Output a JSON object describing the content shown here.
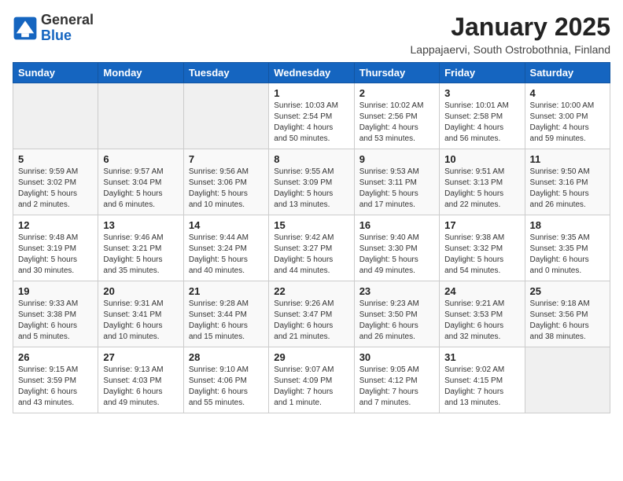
{
  "logo": {
    "general": "General",
    "blue": "Blue"
  },
  "title": "January 2025",
  "subtitle": "Lappajaervi, South Ostrobothnia, Finland",
  "weekdays": [
    "Sunday",
    "Monday",
    "Tuesday",
    "Wednesday",
    "Thursday",
    "Friday",
    "Saturday"
  ],
  "weeks": [
    [
      {
        "day": "",
        "detail": ""
      },
      {
        "day": "",
        "detail": ""
      },
      {
        "day": "",
        "detail": ""
      },
      {
        "day": "1",
        "detail": "Sunrise: 10:03 AM\nSunset: 2:54 PM\nDaylight: 4 hours\nand 50 minutes."
      },
      {
        "day": "2",
        "detail": "Sunrise: 10:02 AM\nSunset: 2:56 PM\nDaylight: 4 hours\nand 53 minutes."
      },
      {
        "day": "3",
        "detail": "Sunrise: 10:01 AM\nSunset: 2:58 PM\nDaylight: 4 hours\nand 56 minutes."
      },
      {
        "day": "4",
        "detail": "Sunrise: 10:00 AM\nSunset: 3:00 PM\nDaylight: 4 hours\nand 59 minutes."
      }
    ],
    [
      {
        "day": "5",
        "detail": "Sunrise: 9:59 AM\nSunset: 3:02 PM\nDaylight: 5 hours\nand 2 minutes."
      },
      {
        "day": "6",
        "detail": "Sunrise: 9:57 AM\nSunset: 3:04 PM\nDaylight: 5 hours\nand 6 minutes."
      },
      {
        "day": "7",
        "detail": "Sunrise: 9:56 AM\nSunset: 3:06 PM\nDaylight: 5 hours\nand 10 minutes."
      },
      {
        "day": "8",
        "detail": "Sunrise: 9:55 AM\nSunset: 3:09 PM\nDaylight: 5 hours\nand 13 minutes."
      },
      {
        "day": "9",
        "detail": "Sunrise: 9:53 AM\nSunset: 3:11 PM\nDaylight: 5 hours\nand 17 minutes."
      },
      {
        "day": "10",
        "detail": "Sunrise: 9:51 AM\nSunset: 3:13 PM\nDaylight: 5 hours\nand 22 minutes."
      },
      {
        "day": "11",
        "detail": "Sunrise: 9:50 AM\nSunset: 3:16 PM\nDaylight: 5 hours\nand 26 minutes."
      }
    ],
    [
      {
        "day": "12",
        "detail": "Sunrise: 9:48 AM\nSunset: 3:19 PM\nDaylight: 5 hours\nand 30 minutes."
      },
      {
        "day": "13",
        "detail": "Sunrise: 9:46 AM\nSunset: 3:21 PM\nDaylight: 5 hours\nand 35 minutes."
      },
      {
        "day": "14",
        "detail": "Sunrise: 9:44 AM\nSunset: 3:24 PM\nDaylight: 5 hours\nand 40 minutes."
      },
      {
        "day": "15",
        "detail": "Sunrise: 9:42 AM\nSunset: 3:27 PM\nDaylight: 5 hours\nand 44 minutes."
      },
      {
        "day": "16",
        "detail": "Sunrise: 9:40 AM\nSunset: 3:30 PM\nDaylight: 5 hours\nand 49 minutes."
      },
      {
        "day": "17",
        "detail": "Sunrise: 9:38 AM\nSunset: 3:32 PM\nDaylight: 5 hours\nand 54 minutes."
      },
      {
        "day": "18",
        "detail": "Sunrise: 9:35 AM\nSunset: 3:35 PM\nDaylight: 6 hours\nand 0 minutes."
      }
    ],
    [
      {
        "day": "19",
        "detail": "Sunrise: 9:33 AM\nSunset: 3:38 PM\nDaylight: 6 hours\nand 5 minutes."
      },
      {
        "day": "20",
        "detail": "Sunrise: 9:31 AM\nSunset: 3:41 PM\nDaylight: 6 hours\nand 10 minutes."
      },
      {
        "day": "21",
        "detail": "Sunrise: 9:28 AM\nSunset: 3:44 PM\nDaylight: 6 hours\nand 15 minutes."
      },
      {
        "day": "22",
        "detail": "Sunrise: 9:26 AM\nSunset: 3:47 PM\nDaylight: 6 hours\nand 21 minutes."
      },
      {
        "day": "23",
        "detail": "Sunrise: 9:23 AM\nSunset: 3:50 PM\nDaylight: 6 hours\nand 26 minutes."
      },
      {
        "day": "24",
        "detail": "Sunrise: 9:21 AM\nSunset: 3:53 PM\nDaylight: 6 hours\nand 32 minutes."
      },
      {
        "day": "25",
        "detail": "Sunrise: 9:18 AM\nSunset: 3:56 PM\nDaylight: 6 hours\nand 38 minutes."
      }
    ],
    [
      {
        "day": "26",
        "detail": "Sunrise: 9:15 AM\nSunset: 3:59 PM\nDaylight: 6 hours\nand 43 minutes."
      },
      {
        "day": "27",
        "detail": "Sunrise: 9:13 AM\nSunset: 4:03 PM\nDaylight: 6 hours\nand 49 minutes."
      },
      {
        "day": "28",
        "detail": "Sunrise: 9:10 AM\nSunset: 4:06 PM\nDaylight: 6 hours\nand 55 minutes."
      },
      {
        "day": "29",
        "detail": "Sunrise: 9:07 AM\nSunset: 4:09 PM\nDaylight: 7 hours\nand 1 minute."
      },
      {
        "day": "30",
        "detail": "Sunrise: 9:05 AM\nSunset: 4:12 PM\nDaylight: 7 hours\nand 7 minutes."
      },
      {
        "day": "31",
        "detail": "Sunrise: 9:02 AM\nSunset: 4:15 PM\nDaylight: 7 hours\nand 13 minutes."
      },
      {
        "day": "",
        "detail": ""
      }
    ]
  ]
}
